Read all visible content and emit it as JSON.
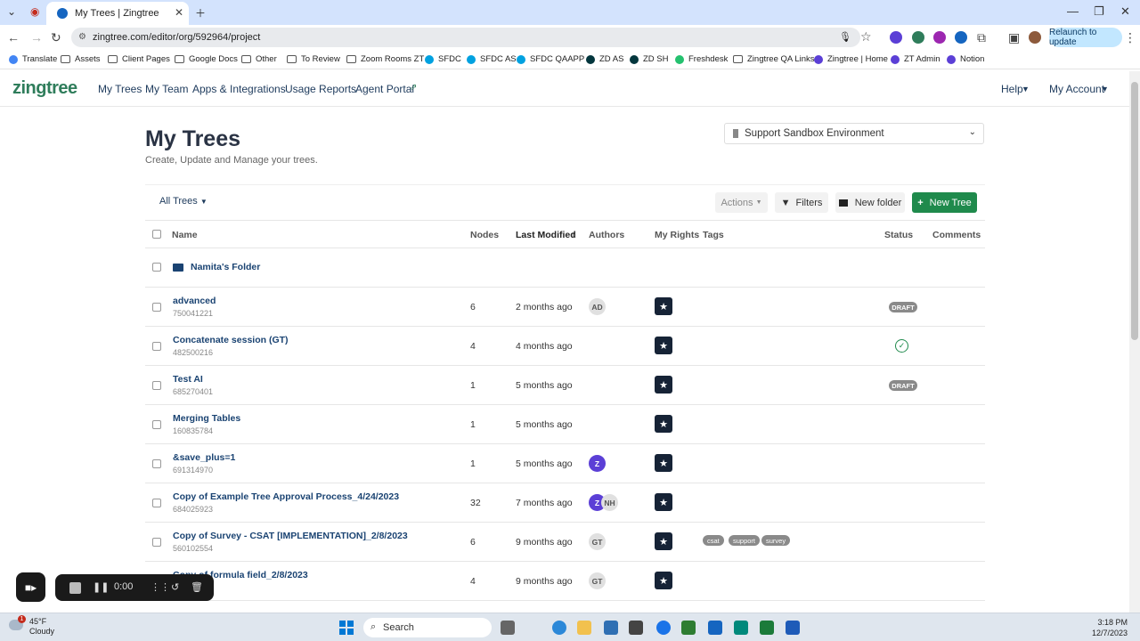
{
  "browser": {
    "tab_title": "My Trees | Zingtree",
    "url": "zingtree.com/editor/org/592964/project",
    "relaunch_label": "Relaunch to update"
  },
  "bookmarks": [
    "Translate",
    "Assets",
    "Client Pages",
    "Google Docs",
    "Other",
    "To Review",
    "Zoom Rooms ZT",
    "SFDC",
    "SFDC AS",
    "SFDC QAAPP",
    "ZD AS",
    "ZD SH",
    "Freshdesk",
    "Zingtree QA Links",
    "Zingtree | Home",
    "ZT Admin",
    "Notion"
  ],
  "app": {
    "logo": "zingtree",
    "nav": [
      "My Trees",
      "My Team",
      "Apps & Integrations",
      "Usage Reports",
      "Agent Portal"
    ],
    "help": "Help",
    "account": "My Account"
  },
  "page": {
    "title": "My Trees",
    "subtitle": "Create, Update and Manage your trees.",
    "environment": "Support Sandbox Environment"
  },
  "toolbar": {
    "all_trees": "All Trees",
    "actions": "Actions",
    "filters": "Filters",
    "new_folder": "New folder",
    "new_tree": "New Tree"
  },
  "columns": {
    "name": "Name",
    "nodes": "Nodes",
    "last_modified": "Last Modified",
    "authors": "Authors",
    "my_rights": "My Rights",
    "tags": "Tags",
    "status": "Status",
    "comments": "Comments"
  },
  "folder": {
    "name": "Namita's Folder"
  },
  "rows": [
    {
      "name": "advanced",
      "id": "750041221",
      "nodes": "6",
      "modified": "2 months ago",
      "authors": [
        "AD"
      ],
      "status": "DRAFT",
      "tags": []
    },
    {
      "name": "Concatenate session (GT)",
      "id": "482500216",
      "nodes": "4",
      "modified": "4 months ago",
      "authors": [],
      "status": "check",
      "tags": []
    },
    {
      "name": "Test AI",
      "id": "685270401",
      "nodes": "1",
      "modified": "5 months ago",
      "authors": [],
      "status": "DRAFT",
      "tags": []
    },
    {
      "name": "Merging Tables",
      "id": "160835784",
      "nodes": "1",
      "modified": "5 months ago",
      "authors": [],
      "status": "",
      "tags": []
    },
    {
      "name": "&save_plus=1",
      "id": "691314970",
      "nodes": "1",
      "modified": "5 months ago",
      "authors": [
        "Z"
      ],
      "status": "",
      "tags": []
    },
    {
      "name": "Copy of Example Tree Approval Process_4/24/2023",
      "id": "684025923",
      "nodes": "32",
      "modified": "7 months ago",
      "authors": [
        "Z",
        "NH"
      ],
      "status": "",
      "tags": []
    },
    {
      "name": "Copy of Survey - CSAT [IMPLEMENTATION]_2/8/2023",
      "id": "560102554",
      "nodes": "6",
      "modified": "9 months ago",
      "authors": [
        "GT"
      ],
      "status": "",
      "tags": [
        "csat",
        "support",
        "survey"
      ]
    },
    {
      "name": "Copy of formula field_2/8/2023",
      "id": "",
      "nodes": "4",
      "modified": "9 months ago",
      "authors": [
        "GT"
      ],
      "status": "",
      "tags": []
    }
  ],
  "recorder": {
    "time": "0:00"
  },
  "taskbar": {
    "weather_temp": "45°F",
    "weather_desc": "Cloudy",
    "weather_badge": "1",
    "search": "Search",
    "time": "3:18 PM",
    "date": "12/7/2023"
  },
  "colors": {
    "brand_green": "#1f8a4c",
    "link_blue": "#1a4372",
    "star_bg": "#162336"
  }
}
